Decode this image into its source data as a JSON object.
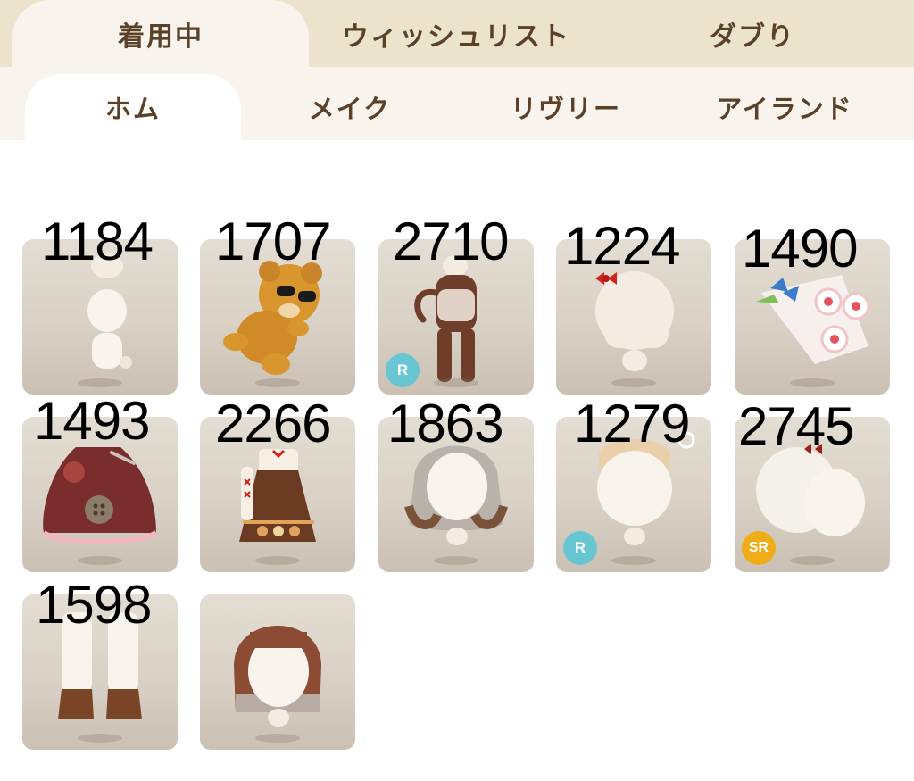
{
  "top_tabs": [
    {
      "label": "着用中",
      "active": true
    },
    {
      "label": "ウィッシュリスト",
      "active": false
    },
    {
      "label": "ダブり",
      "active": false
    }
  ],
  "sub_tabs": [
    {
      "label": "ホム",
      "active": true
    },
    {
      "label": "メイク",
      "active": false
    },
    {
      "label": "リヴリー",
      "active": false
    },
    {
      "label": "アイランド",
      "active": false
    }
  ],
  "items": [
    {
      "number": "1184",
      "icon": "ornament-outfit-icon",
      "badge": ""
    },
    {
      "number": "1707",
      "icon": "bear-with-sunglasses-icon",
      "badge": ""
    },
    {
      "number": "2710",
      "icon": "brown-body-suit-icon",
      "badge": "R"
    },
    {
      "number": "1224",
      "icon": "red-ribbon-hair-icon",
      "badge": ""
    },
    {
      "number": "1490",
      "icon": "flower-bouquet-icon",
      "badge": ""
    },
    {
      "number": "1493",
      "icon": "button-cape-icon",
      "badge": ""
    },
    {
      "number": "2266",
      "icon": "brown-dress-icon",
      "badge": ""
    },
    {
      "number": "1863",
      "icon": "gray-wavy-hair-icon",
      "badge": ""
    },
    {
      "number": "1279",
      "icon": "beige-hair-icon",
      "badge": "R"
    },
    {
      "number": "2745",
      "icon": "white-hood-icon",
      "badge": "SR"
    },
    {
      "number": "1598",
      "icon": "brown-boots-icon",
      "badge": ""
    },
    {
      "number": "",
      "icon": "brown-bob-hair-icon",
      "badge": ""
    }
  ],
  "colors": {
    "tab_bar": "#ece3cd",
    "sub_tab_bar": "#f8f3ec",
    "tab_text": "#5a4128",
    "badge_r": "#67c6d2",
    "badge_sr": "#f0ad18"
  }
}
